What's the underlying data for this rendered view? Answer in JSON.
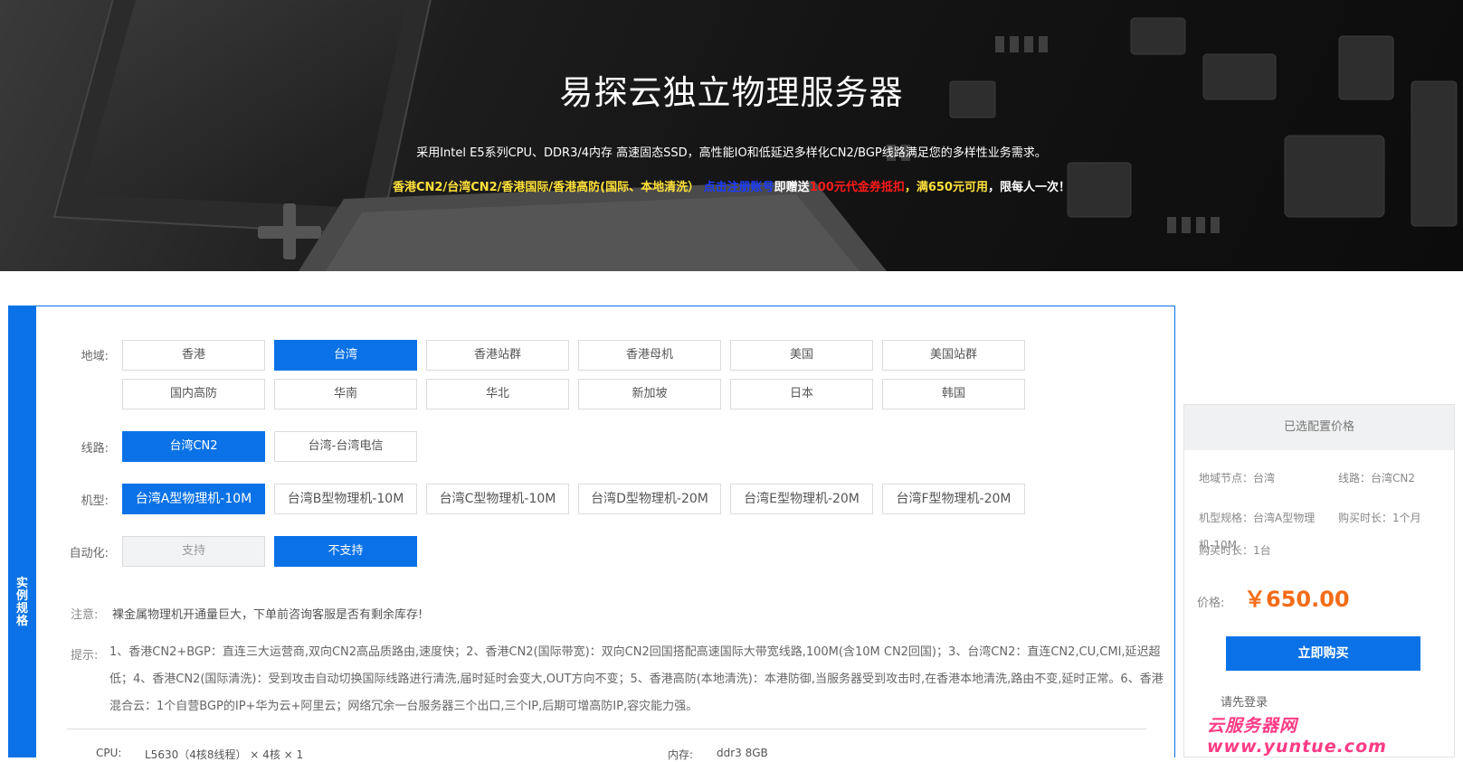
{
  "hero": {
    "title": "易探云独立物理服务器",
    "subtitle": "采用Intel E5系列CPU、DDR3/4内存 高速固态SSD，高性能IO和低延迟多样化CN2/BGP线路满足您的多样性业务需求。",
    "promo": {
      "lines_text": "香港CN2/台湾CN2/香港国际/香港高防(国际、本地清洗）",
      "register_link": "点击注册账号",
      "gift_text": "即赠送",
      "coupon_text": "100元代金券抵扣",
      "condition_text": "，满650元可用",
      "limit_text": "，限每人一次！"
    }
  },
  "panel": {
    "side_tab": "实例规格",
    "region": {
      "label": "地域:",
      "options": [
        "香港",
        "台湾",
        "香港站群",
        "香港母机",
        "美国",
        "美国站群",
        "国内高防",
        "华南",
        "华北",
        "新加坡",
        "日本",
        "韩国"
      ],
      "selected": "台湾"
    },
    "line": {
      "label": "线路:",
      "options": [
        "台湾CN2",
        "台湾-台湾电信"
      ],
      "selected": "台湾CN2"
    },
    "model": {
      "label": "机型:",
      "options": [
        "台湾A型物理机-10M",
        "台湾B型物理机-10M",
        "台湾C型物理机-10M",
        "台湾D型物理机-20M",
        "台湾E型物理机-20M",
        "台湾F型物理机-20M"
      ],
      "selected": "台湾A型物理机-10M"
    },
    "auto": {
      "label": "自动化:",
      "options": [
        "支持",
        "不支持"
      ],
      "selected": "不支持"
    },
    "notice": {
      "label": "注意:",
      "text": "裸金属物理机开通量巨大，下单前咨询客服是否有剩余库存!"
    },
    "tip": {
      "label": "提示:",
      "text": "1、香港CN2+BGP：直连三大运营商,双向CN2高品质路由,速度快；2、香港CN2(国际带宽)：双向CN2回国搭配高速国际大带宽线路,100M(含10M CN2回国)；3、台湾CN2：直连CN2,CU,CMI,延迟超低；4、香港CN2(国际清洗)：受到攻击自动切换国际线路进行清洗,届时延时会变大,OUT方向不变；5、香港高防(本地清洗)：本港防御,当服务器受到攻击时,在香港本地清洗,路由不变,延时正常。6、香港混合云：1个自营BGP的IP+华为云+阿里云；网络冗余一台服务器三个出口,三个IP,后期可增高防IP,容灾能力强。"
    },
    "spec": {
      "cpu_label": "CPU:",
      "cpu_value": "L5630（4核8线程） × 4核 × 1",
      "mem_label": "内存:",
      "mem_value": "ddr3 8GB"
    }
  },
  "summary": {
    "title": "已选配置价格",
    "region": "地域节点：台湾",
    "line": "线路：台湾CN2",
    "model": "机型规格：台湾A型物理机-10M",
    "duration": "购买时长：1个月",
    "quantity": "购买时长：1台",
    "price_label": "价格:",
    "price": "￥650.00",
    "buy_button": "立即购买",
    "login_text": "请先登录"
  },
  "watermark": "云服务器网 www.yuntue.com",
  "colors": {
    "primary": "#0a72e6",
    "price": "#f46c18",
    "promo_yellow": "#ffe13a",
    "promo_red": "#ff1a1a",
    "promo_blue": "#1a3cff"
  }
}
